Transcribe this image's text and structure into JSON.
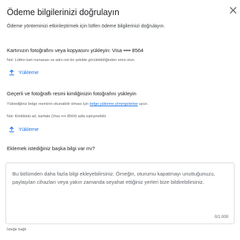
{
  "dialog": {
    "title": "Ödeme bilgilerinizi doğrulayın",
    "subtitle": "Ödeme yönteminizi etkinleştirmek için lütfen ödeme bilgilerinizi doğrulayın."
  },
  "card_section": {
    "title": "Kartınızın fotoğrafını veya kopyasını yükleyin: Visa •••• 8564",
    "note": "Not: Lütfen kart numarası ve adın net bir şekilde görülebildiğinden emin olun.",
    "upload_label": "Yükleme"
  },
  "id_section": {
    "title": "Geçerli ve fotoğraflı resmi kimliğinizin fotoğrafını yükleyin",
    "note_before_link": "Yüklediğiniz belge resminin okunabilir olması için ",
    "note_link": "belge yükleme yönergelerine",
    "note_after_link": " uyun.",
    "note2": "Not: Kimlikteki ad, karttaki (Visa •••• 8564) adla eşleşmelidir.",
    "upload_label": "Yükleme"
  },
  "extra_section": {
    "title": "Eklemek istediğiniz başka bilgi var mı?",
    "placeholder": "Bu bölümden daha fazla bilgi ekleyebilirsiniz. Örneğin, oturumu kapatmayı unuttuğunuzu, paylaşılan cihazları veya yakın zamanda seyahat ettiğiniz yerleri bize bildirebilirsiniz.",
    "counter": "0/1.000",
    "optional_label": "İsteğe bağlı"
  },
  "icons": {
    "close": "close-icon",
    "upload": "upload-icon"
  },
  "colors": {
    "accent": "#1a73e8",
    "text": "#202124",
    "muted": "#5f6368",
    "border": "#dadce0"
  }
}
